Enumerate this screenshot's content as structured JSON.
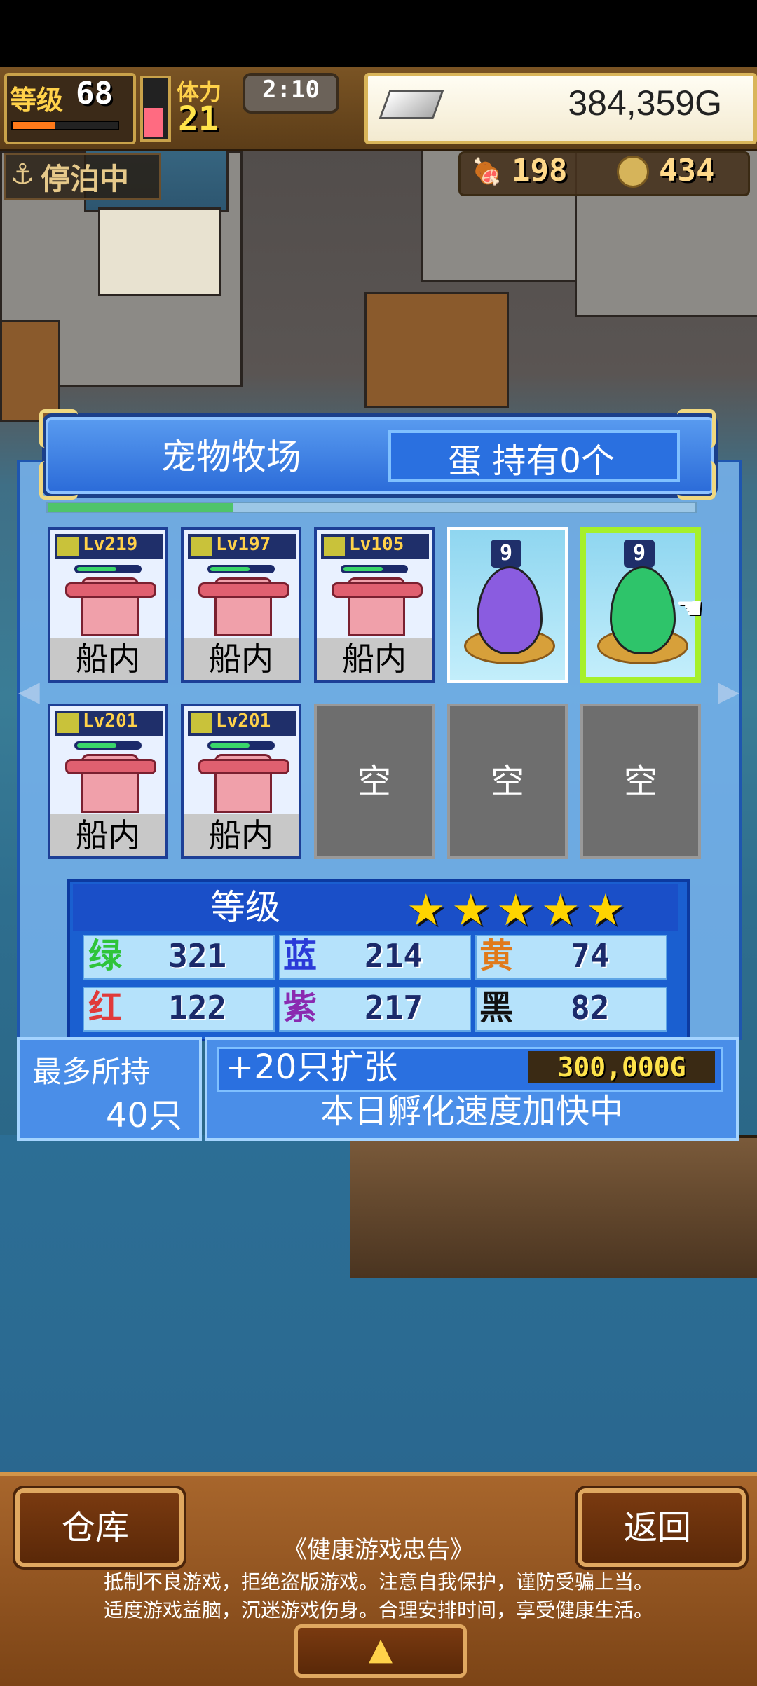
{
  "hud": {
    "level_label": "等级",
    "level_value": "68",
    "level_progress": 0.4,
    "stamina_label": "体力",
    "stamina_value": "21",
    "stamina_fill": 0.5,
    "time": "2:10",
    "money": "384,359G",
    "dock_status": "停泊中",
    "food": "198",
    "coins": "434"
  },
  "ranch": {
    "title": "宠物牧场",
    "egg_count": "蛋 持有0个",
    "slots_row1": [
      {
        "type": "pet",
        "level": "Lv219",
        "location": "船内"
      },
      {
        "type": "pet",
        "level": "Lv197",
        "location": "船内"
      },
      {
        "type": "pet",
        "level": "Lv105",
        "location": "船内"
      },
      {
        "type": "egg",
        "count": "9",
        "color": "#8a5ce0",
        "selected": false
      },
      {
        "type": "egg",
        "count": "9",
        "color": "#2ec46a",
        "selected": true
      }
    ],
    "slots_row2": [
      {
        "type": "pet",
        "level": "Lv201",
        "location": "船内"
      },
      {
        "type": "pet",
        "level": "Lv201",
        "location": "船内"
      },
      {
        "type": "empty",
        "label": "空"
      },
      {
        "type": "empty",
        "label": "空"
      },
      {
        "type": "empty",
        "label": "空"
      }
    ],
    "rank_label": "等级",
    "rank_stars": 5,
    "stats": [
      {
        "name": "绿",
        "value": "321",
        "color": "#2ec43a"
      },
      {
        "name": "蓝",
        "value": "214",
        "color": "#2a3ad8"
      },
      {
        "name": "黄",
        "value": "74",
        "color": "#e07a1a"
      },
      {
        "name": "红",
        "value": "122",
        "color": "#e03a3a"
      },
      {
        "name": "紫",
        "value": "217",
        "color": "#8a2ab0"
      },
      {
        "name": "黑",
        "value": "82",
        "color": "#111111"
      }
    ],
    "max_label": "最多所持",
    "max_value": "40只",
    "expand_label": "+20只扩张",
    "expand_cost": "300,000G",
    "hatch_status": "本日孵化速度加快中"
  },
  "footer": {
    "warehouse_button": "仓库",
    "back_button": "返回",
    "notice_title": "《健康游戏忠告》",
    "notice_line1": "抵制不良游戏，拒绝盗版游戏。注意自我保护，谨防受骗上当。",
    "notice_line2": "适度游戏益脑，沉迷游戏伤身。合理安排时间，享受健康生活。",
    "up_icon": "up-arrow-icon"
  }
}
